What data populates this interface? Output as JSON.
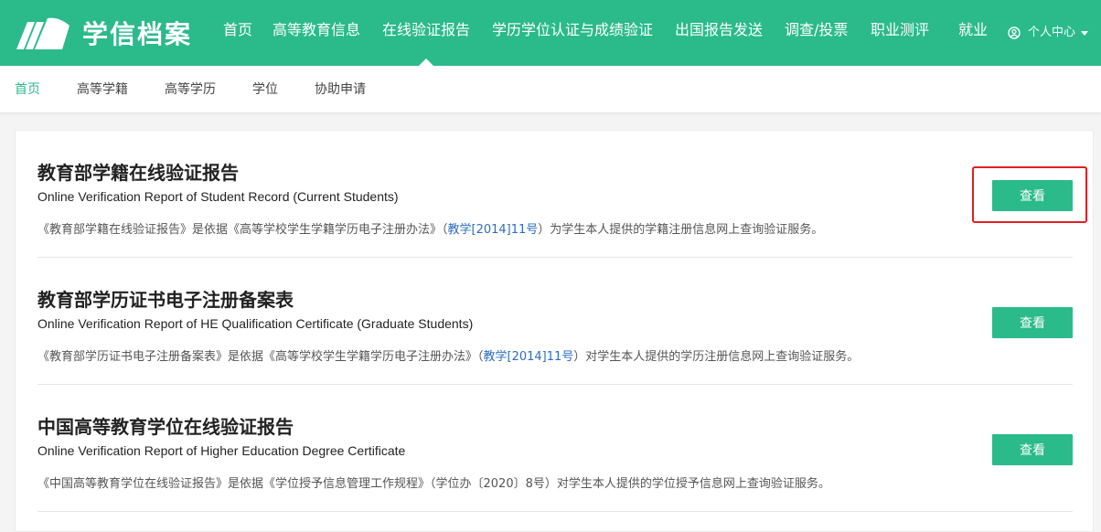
{
  "header": {
    "logo_text": "学信档案",
    "nav": [
      {
        "label": "首页"
      },
      {
        "label": "高等教育信息"
      },
      {
        "label": "在线验证报告",
        "active": true
      },
      {
        "label": "学历学位认证与成绩验证"
      },
      {
        "label": "出国报告发送"
      },
      {
        "label": "调查/投票"
      },
      {
        "label": "职业测评"
      },
      {
        "label": "就业"
      }
    ],
    "user_menu_label": "个人中心",
    "user_icon": "user-circle-icon"
  },
  "subnav": [
    {
      "label": "首页",
      "active": true
    },
    {
      "label": "高等学籍"
    },
    {
      "label": "高等学历"
    },
    {
      "label": "学位"
    },
    {
      "label": "协助申请"
    }
  ],
  "reports": [
    {
      "title": "教育部学籍在线验证报告",
      "subtitle_en": "Online Verification Report of Student Record (Current Students)",
      "desc_prefix": "《教育部学籍在线验证报告》是依据《高等学校学生学籍学历电子注册办法》（",
      "desc_link": "教学[2014]11号",
      "desc_suffix": "）为学生本人提供的学籍注册信息网上查询验证服务。",
      "button_label": "查看",
      "highlighted": true
    },
    {
      "title": "教育部学历证书电子注册备案表",
      "subtitle_en": "Online Verification Report of HE Qualification Certificate (Graduate Students)",
      "desc_prefix": "《教育部学历证书电子注册备案表》是依据《高等学校学生学籍学历电子注册办法》（",
      "desc_link": "教学[2014]11号",
      "desc_suffix": "）对学生本人提供的学历注册信息网上查询验证服务。",
      "button_label": "查看"
    },
    {
      "title": "中国高等教育学位在线验证报告",
      "subtitle_en": "Online Verification Report of Higher Education Degree Certificate",
      "desc_prefix": "《中国高等教育学位在线验证报告》是依据《学位授予信息管理工作规程》（学位办〔2020〕8号）对学生本人提供的学位授予信息网上查询验证服务。",
      "desc_link": "",
      "desc_suffix": "",
      "button_label": "查看"
    }
  ],
  "colors": {
    "brand_green": "#2bba8a",
    "link_blue": "#2b6cc4",
    "highlight_red": "#e02020"
  }
}
